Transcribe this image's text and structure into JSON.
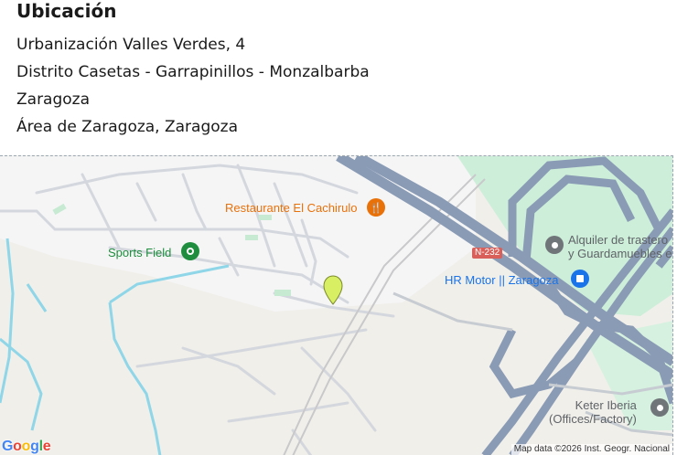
{
  "location": {
    "heading": "Ubicación",
    "address_lines": [
      "Urbanización Valles Verdes, 4",
      "Distrito Casetas - Garrapinillos - Monzalbarba",
      "Zaragoza",
      "Área de Zaragoza, Zaragoza"
    ]
  },
  "map": {
    "labels": {
      "restaurant": "Restaurante El Cachirulo",
      "sports_field": "Sports Field",
      "road_badge": "N-232",
      "storage_line1": "Alquiler de trastero",
      "storage_line2": "y Guardamuebles e",
      "hr_motor": "HR Motor || Zaragoza",
      "keter_line1": "Keter Iberia",
      "keter_line2": "(Offices/Factory)"
    },
    "icons": {
      "restaurant": "fork-knife-icon",
      "sports_field": "sports-field-icon",
      "storage": "place-icon",
      "hr_motor": "shopping-bag-icon",
      "keter": "place-icon",
      "marker": "location-marker-icon"
    },
    "google_logo": "Google",
    "attribution": "Map data ©2026 Inst. Geogr. Nacional",
    "colors": {
      "restaurant": "#e8710a",
      "green_poi": "#1e8e3e",
      "shopping": "#1a73e8",
      "grey_poi": "#70757a",
      "marker": "#d8ef63",
      "water": "#8fd6e8",
      "highway": "#8a9bb5",
      "park": "#cdeed9"
    }
  }
}
